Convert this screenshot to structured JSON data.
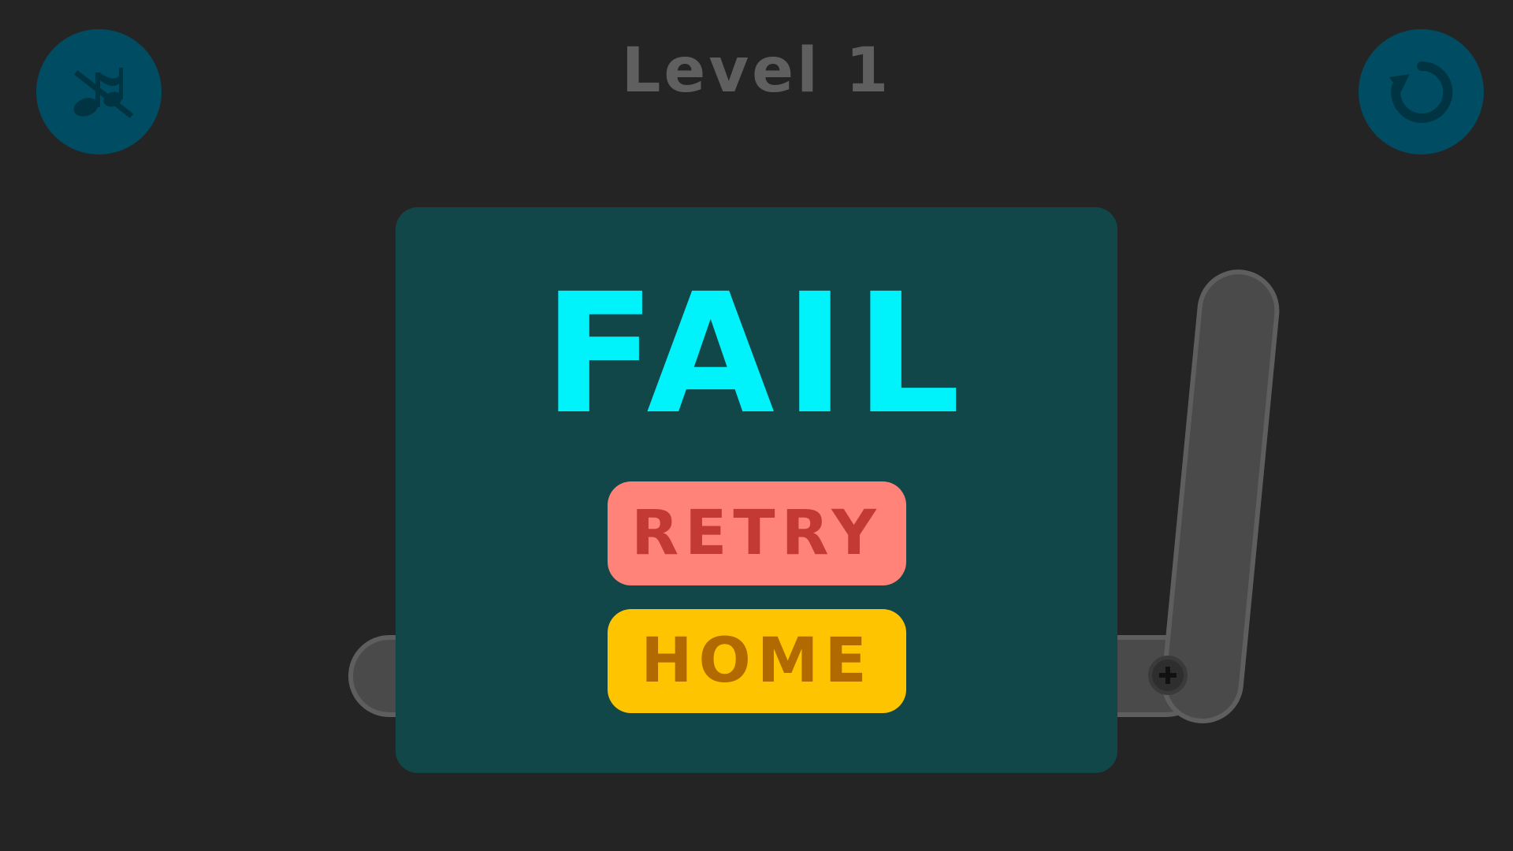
{
  "header": {
    "level_title": "Level 1"
  },
  "controls": {
    "music_icon": "music-muted-icon",
    "restart_icon": "restart-icon"
  },
  "dialog": {
    "title": "FAIL",
    "retry_label": "RETRY",
    "home_label": "HOME"
  },
  "colors": {
    "background": "#242424",
    "dialog": "#12474a",
    "title": "#00f2fb",
    "round_button": "#004d63",
    "retry_bg": "#ff8378",
    "retry_text": "#c23a33",
    "home_bg": "#ffc400",
    "home_text": "#b06a00"
  }
}
